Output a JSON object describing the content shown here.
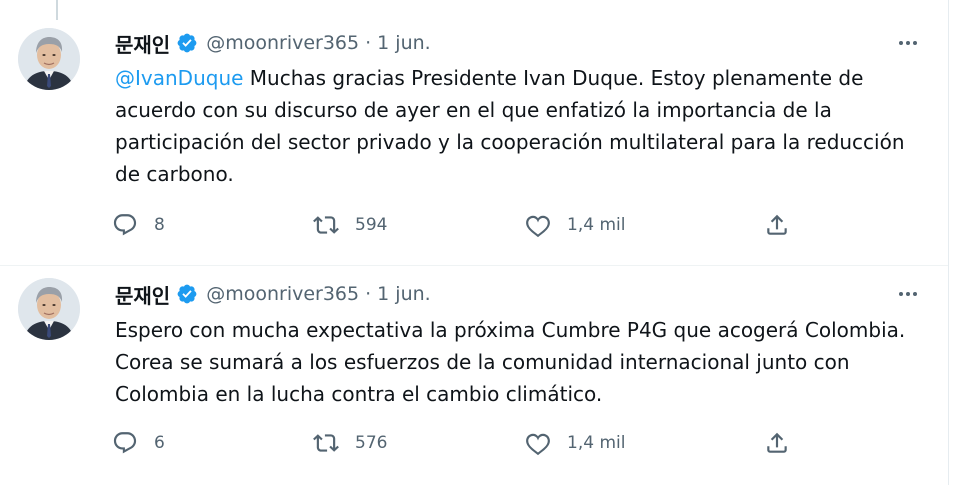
{
  "tweets": [
    {
      "author_name": "문재인",
      "handle": "@moonriver365",
      "separator": "·",
      "date": "1 jun.",
      "mention": "@IvanDuque",
      "text": " Muchas gracias Presidente Ivan Duque. Estoy plenamente de acuerdo con su discurso de ayer en el que enfatizó la importancia de la participación del sector privado y la cooperación multilateral para la reducción de carbono.",
      "replies": "8",
      "retweets": "594",
      "likes": "1,4 mil"
    },
    {
      "author_name": "문재인",
      "handle": "@moonriver365",
      "separator": "·",
      "date": "1 jun.",
      "text": "Espero con mucha expectativa la próxima Cumbre P4G que acogerá Colombia. Corea se sumará a los esfuerzos de la comunidad internacional junto con Colombia en la lucha contra el cambio climático.",
      "replies": "6",
      "retweets": "576",
      "likes": "1,4 mil"
    }
  ],
  "icons": {
    "verified": "verified-badge-icon",
    "more": "more-horizontal-icon",
    "reply": "reply-bubble-icon",
    "retweet": "retweet-icon",
    "like": "heart-icon",
    "share": "share-upload-icon"
  },
  "colors": {
    "accent": "#1d9bf0",
    "text_primary": "#0f1419",
    "text_secondary": "#536471",
    "divider": "#eff3f4"
  }
}
